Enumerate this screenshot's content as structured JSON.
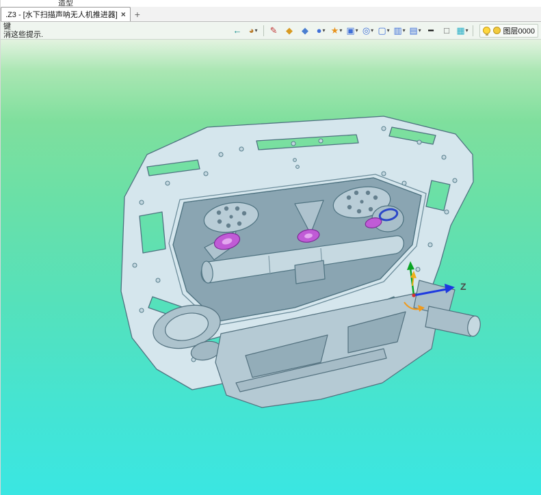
{
  "topbar": {
    "ribbon_fragment": "造型"
  },
  "tabbar": {
    "document_tab_label": ".Z3 - [水下扫描声呐无人机推进器]",
    "close_tab_label": "×",
    "new_tab_label": "+"
  },
  "hints": {
    "line1": "键",
    "line2": "消这些提示."
  },
  "toolbar": {
    "dropdown_glyph": "▾",
    "icons": [
      {
        "name": "exit-view-icon",
        "glyph": "←",
        "color": "#0d8888",
        "dropdown": false
      },
      {
        "name": "render-mode-icon",
        "glyph": "◕",
        "color": "#b87a2a",
        "dropdown": true
      },
      {
        "separator": true
      },
      {
        "name": "brush-icon",
        "glyph": "✎",
        "color": "#c03434",
        "dropdown": false
      },
      {
        "name": "gold-solid-icon",
        "glyph": "◆",
        "color": "#d89a22",
        "dropdown": false
      },
      {
        "name": "blue-solid-icon",
        "glyph": "◆",
        "color": "#4a7ed0",
        "dropdown": false
      },
      {
        "name": "sphere-display-icon",
        "glyph": "●",
        "color": "#3f6fd8",
        "dropdown": true
      },
      {
        "name": "pinwheel-icon",
        "glyph": "★",
        "color": "#e8931d",
        "dropdown": true
      },
      {
        "name": "frame-display-icon",
        "glyph": "▣",
        "color": "#3f6fd8",
        "dropdown": true
      },
      {
        "name": "target-icon",
        "glyph": "◎",
        "color": "#3f6fd8",
        "dropdown": true
      },
      {
        "name": "window-display-icon",
        "glyph": "▢",
        "color": "#3f6fd8",
        "dropdown": true
      },
      {
        "name": "section-view-icon",
        "glyph": "▥",
        "color": "#3f6fd8",
        "dropdown": true
      },
      {
        "name": "monitor-icon",
        "glyph": "▤",
        "color": "#3f6fd8",
        "dropdown": true
      },
      {
        "name": "black-bar-icon",
        "glyph": "━",
        "color": "#111111",
        "dropdown": false
      },
      {
        "name": "blank-square-icon",
        "glyph": "□",
        "color": "#555555",
        "dropdown": false
      },
      {
        "name": "layers-icon",
        "glyph": "▦",
        "color": "#2ab0c8",
        "dropdown": true
      },
      {
        "separator": true
      }
    ],
    "layer": {
      "label": "图层0000"
    }
  },
  "viewport": {
    "axis_z_label": "Z"
  },
  "colors": {
    "viewport_gradient_top": "#e3f3e0",
    "viewport_gradient_mid": "#6ae0a7",
    "viewport_gradient_bottom": "#3ae6e2",
    "model_fill": "#d5e6ed",
    "model_stroke": "#4e7280",
    "prop_disc": "#c05bd6",
    "axis_x_color": "#f09a1c",
    "axis_y_color": "#0aa424",
    "axis_z_color": "#1d39e0"
  }
}
